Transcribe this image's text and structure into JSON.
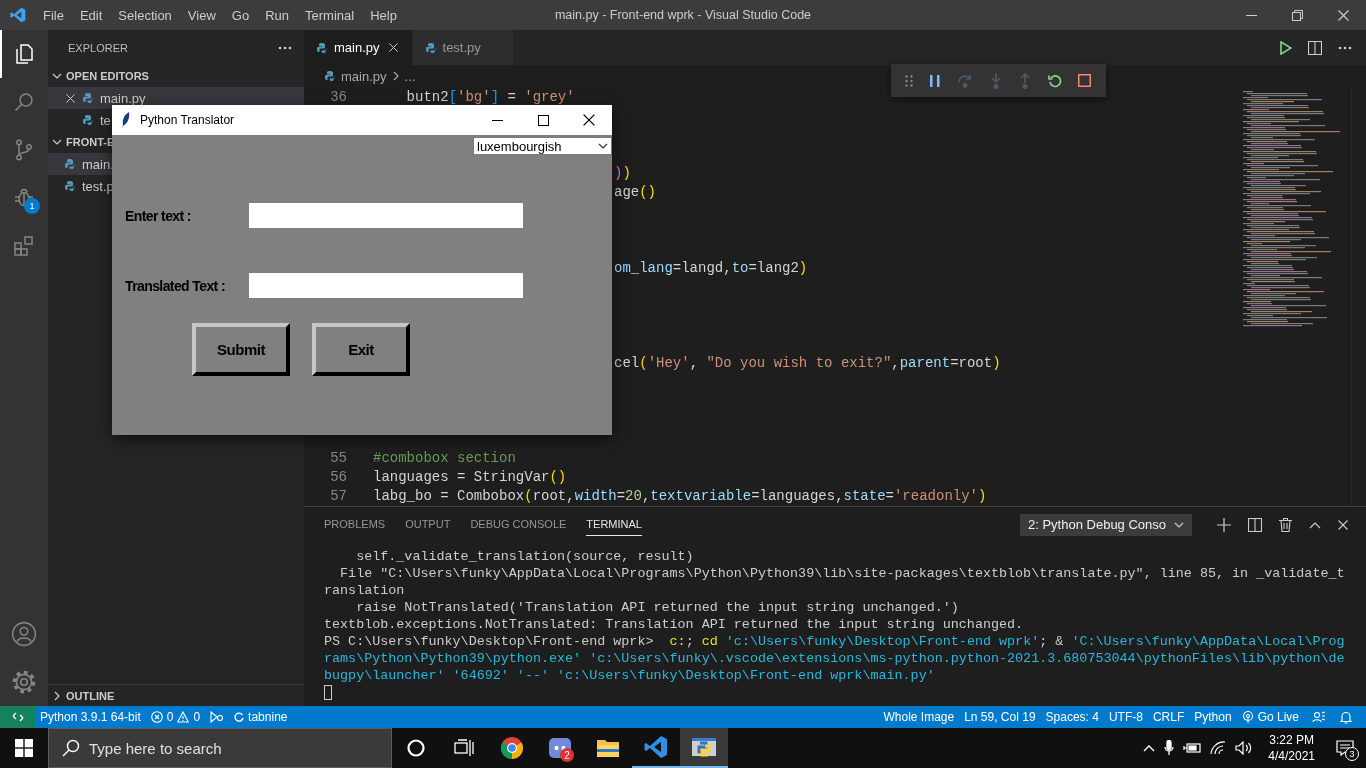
{
  "window": {
    "title": "main.py - Front-end wprk - Visual Studio Code",
    "menu": [
      "File",
      "Edit",
      "Selection",
      "View",
      "Go",
      "Run",
      "Terminal",
      "Help"
    ]
  },
  "activity_bar": {
    "items": [
      {
        "kind": "files",
        "selected": true
      },
      {
        "kind": "search",
        "selected": false
      },
      {
        "kind": "source-control",
        "selected": false
      },
      {
        "kind": "debug",
        "selected": false,
        "badge": "1"
      },
      {
        "kind": "extensions",
        "selected": false
      }
    ],
    "bottom": [
      {
        "kind": "account"
      },
      {
        "kind": "settings"
      }
    ]
  },
  "sidebar": {
    "title": "EXPLORER",
    "sections": [
      {
        "title": "OPEN EDITORS",
        "expanded": true,
        "items": [
          {
            "label": "main.py",
            "selected": true
          },
          {
            "label": "te",
            "selected": false
          }
        ]
      },
      {
        "title": "FRONT-E",
        "expanded": true,
        "items": [
          {
            "label": "main.",
            "selected": true
          },
          {
            "label": "test.p",
            "selected": false
          }
        ]
      }
    ],
    "outline": {
      "title": "OUTLINE",
      "expanded": false
    }
  },
  "editor": {
    "tabs": [
      {
        "label": "main.py",
        "selected": true
      },
      {
        "label": "test.py",
        "selected": false
      }
    ],
    "breadcrumb": [
      "main.py",
      "..."
    ],
    "lines": [
      {
        "kind": "full",
        "number": "36",
        "tokens": [
          {
            "kind": "plain",
            "t": "    butn2"
          },
          {
            "kind": "blue",
            "t": "["
          },
          {
            "kind": "string",
            "t": "'bg'"
          },
          {
            "kind": "blue",
            "t": "]"
          },
          {
            "kind": "plain",
            "t": " = "
          },
          {
            "kind": "string",
            "t": "'grey'"
          }
        ]
      },
      {
        "kind": "covered"
      },
      {
        "kind": "covered"
      },
      {
        "kind": "covered"
      },
      {
        "kind": "tail",
        "tokens": [
          {
            "kind": "magenta",
            "t": ")"
          },
          {
            "kind": "gold",
            "t": ")"
          }
        ]
      },
      {
        "kind": "tail",
        "tokens": [
          {
            "kind": "plain",
            "t": "age"
          },
          {
            "kind": "gold",
            "t": "()"
          }
        ]
      },
      {
        "kind": "covered"
      },
      {
        "kind": "covered"
      },
      {
        "kind": "covered"
      },
      {
        "kind": "tail",
        "tokens": [
          {
            "kind": "var",
            "t": "om_lang"
          },
          {
            "kind": "plain",
            "t": "=langd,"
          },
          {
            "kind": "var",
            "t": "to"
          },
          {
            "kind": "plain",
            "t": "=lang2"
          },
          {
            "kind": "gold",
            "t": ")"
          }
        ]
      },
      {
        "kind": "covered"
      },
      {
        "kind": "covered"
      },
      {
        "kind": "covered"
      },
      {
        "kind": "covered"
      },
      {
        "kind": "tail",
        "tokens": [
          {
            "kind": "plain",
            "t": "cel"
          },
          {
            "kind": "gold",
            "t": "("
          },
          {
            "kind": "string",
            "t": "'Hey'"
          },
          {
            "kind": "plain",
            "t": ", "
          },
          {
            "kind": "string",
            "t": "\"Do you wish to exit?\""
          },
          {
            "kind": "plain",
            "t": ","
          },
          {
            "kind": "var",
            "t": "parent"
          },
          {
            "kind": "plain",
            "t": "=root"
          },
          {
            "kind": "gold",
            "t": ")"
          }
        ]
      },
      {
        "kind": "covered"
      },
      {
        "kind": "covered"
      },
      {
        "kind": "covered"
      },
      {
        "kind": "covered"
      },
      {
        "kind": "full",
        "number": "55",
        "tokens": [
          {
            "kind": "comment",
            "t": "#combobox section"
          }
        ]
      },
      {
        "kind": "full",
        "number": "56",
        "tokens": [
          {
            "kind": "plain",
            "t": "languages = StringVar"
          },
          {
            "kind": "gold",
            "t": "()"
          }
        ]
      },
      {
        "kind": "full",
        "number": "57",
        "tokens": [
          {
            "kind": "plain",
            "t": "labg_bo = Combobox"
          },
          {
            "kind": "gold",
            "t": "("
          },
          {
            "kind": "plain",
            "t": "root,"
          },
          {
            "kind": "var",
            "t": "width"
          },
          {
            "kind": "plain",
            "t": "="
          },
          {
            "kind": "number",
            "t": "20"
          },
          {
            "kind": "plain",
            "t": ","
          },
          {
            "kind": "var",
            "t": "textvariable"
          },
          {
            "kind": "plain",
            "t": "=languages,"
          },
          {
            "kind": "var",
            "t": "state"
          },
          {
            "kind": "plain",
            "t": "="
          },
          {
            "kind": "string",
            "t": "'readonly'"
          },
          {
            "kind": "gold",
            "t": ")"
          }
        ]
      }
    ]
  },
  "debug_toolbar": {
    "items": [
      {
        "kind": "grip"
      },
      {
        "kind": "pause",
        "disabled": false
      },
      {
        "kind": "step-over",
        "disabled": true
      },
      {
        "kind": "step-into",
        "disabled": true
      },
      {
        "kind": "step-out",
        "disabled": true
      },
      {
        "kind": "restart",
        "disabled": false
      },
      {
        "kind": "stop",
        "disabled": false
      }
    ]
  },
  "panel": {
    "tabs": [
      {
        "label": "PROBLEMS",
        "selected": false
      },
      {
        "label": "OUTPUT",
        "selected": false
      },
      {
        "label": "DEBUG CONSOLE",
        "selected": false
      },
      {
        "label": "TERMINAL",
        "selected": true
      }
    ],
    "terminal_select": "2: Python Debug Conso",
    "terminal": [
      [
        {
          "kind": "plain",
          "t": "    self._validate_translation(source, result)"
        }
      ],
      [
        {
          "kind": "plain",
          "t": "  File \"C:\\Users\\funky\\AppData\\Local\\Programs\\Python\\Python39\\lib\\site-packages\\textblob\\translate.py\", line 85, in _validate_t"
        }
      ],
      [
        {
          "kind": "plain",
          "t": "ranslation"
        }
      ],
      [
        {
          "kind": "plain",
          "t": "    raise NotTranslated('Translation API returned the input string unchanged.')"
        }
      ],
      [
        {
          "kind": "plain",
          "t": "textblob.exceptions.NotTranslated: Translation API returned the input string unchanged."
        }
      ],
      [
        {
          "kind": "plain",
          "t": "PS C:\\Users\\funky\\Desktop\\Front-end wprk>  "
        },
        {
          "kind": "cmd",
          "t": "c:"
        },
        {
          "kind": "plain",
          "t": "; "
        },
        {
          "kind": "cmd",
          "t": "cd"
        },
        {
          "kind": "arg",
          "t": " 'c:\\Users\\funky\\Desktop\\Front-end wprk'"
        },
        {
          "kind": "plain",
          "t": "; & "
        },
        {
          "kind": "arg",
          "t": "'C:\\Users\\funky\\AppData\\Local\\Prog"
        }
      ],
      [
        {
          "kind": "arg",
          "t": "rams\\Python\\Python39\\python.exe' 'c:\\Users\\funky\\.vscode\\extensions\\ms-python.python-2021.3.680753044\\pythonFiles\\lib\\python\\de"
        }
      ],
      [
        {
          "kind": "arg",
          "t": "bugpy\\launcher' '64692' '--' 'c:\\Users\\funky\\Desktop\\Front-end wprk\\main.py'"
        }
      ]
    ]
  },
  "tk_window": {
    "title": "Python Translator",
    "language": "luxembourgish",
    "fields": [
      {
        "label": "Enter text :"
      },
      {
        "label": "Translated Text :"
      }
    ],
    "buttons": [
      "Submit",
      "Exit"
    ]
  },
  "status_bar": {
    "left": [
      {
        "kind": "remote"
      },
      {
        "kind": "text",
        "label": "Python 3.9.1 64-bit"
      },
      {
        "kind": "problems",
        "errors": "0",
        "warnings": "0"
      },
      {
        "kind": "debug"
      },
      {
        "kind": "tabnine",
        "label": "tabnine"
      }
    ],
    "right": [
      {
        "kind": "text",
        "label": "Whole Image"
      },
      {
        "kind": "text",
        "label": "Ln 59, Col 19"
      },
      {
        "kind": "text",
        "label": "Spaces: 4"
      },
      {
        "kind": "text",
        "label": "UTF-8"
      },
      {
        "kind": "text",
        "label": "CRLF"
      },
      {
        "kind": "text",
        "label": "Python"
      },
      {
        "kind": "live",
        "label": "Go Live"
      },
      {
        "kind": "feedback"
      },
      {
        "kind": "bell"
      }
    ]
  },
  "taskbar": {
    "search": {
      "placeholder": "Type here to search"
    },
    "apps": [
      {
        "kind": "cortana",
        "running": false,
        "selected": false
      },
      {
        "kind": "taskview",
        "running": false,
        "selected": false
      },
      {
        "kind": "chrome",
        "running": false,
        "selected": false
      },
      {
        "kind": "discord",
        "running": false,
        "selected": false,
        "badge": "2"
      },
      {
        "kind": "folder",
        "running": false,
        "selected": false
      },
      {
        "kind": "vscode",
        "running": true,
        "selected": false
      },
      {
        "kind": "python",
        "running": true,
        "selected": true
      }
    ],
    "clock": {
      "time": "3:22 PM",
      "date": "4/4/2021"
    },
    "notifications": "3"
  }
}
